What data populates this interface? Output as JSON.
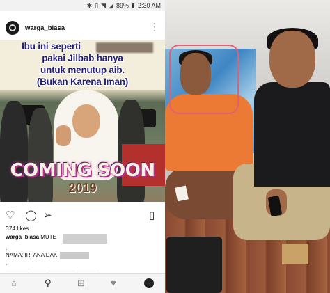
{
  "statusbar": {
    "icons": [
      "bluetooth-icon",
      "vibrate-icon",
      "wifi-icon",
      "signal-icon"
    ],
    "battery": "89%",
    "time": "2:30 AM"
  },
  "post": {
    "username": "warga_biasa",
    "image": {
      "caption_lines": [
        "Ibu ini seperti",
        "pakai Jilbab hanya",
        "untuk menutup aib.",
        "(Bukan Karena Iman)"
      ],
      "headline": "COMING SOON",
      "year": "2019"
    },
    "likes": "374 likes",
    "caption_user": "warga_biasa",
    "caption_text": "MUTE",
    "dot_1": ".",
    "nama": "NAMA: IRI ANA DAKI",
    "dot_2": "."
  },
  "colors": {
    "caption_text": "#231f74",
    "headline_glow": "#b52e8f",
    "highlight_circle": "#e06075",
    "orange_shirt": "#ec7a35"
  },
  "nav": [
    "home-icon",
    "search-icon",
    "add-icon",
    "heart-icon",
    "profile-icon"
  ]
}
